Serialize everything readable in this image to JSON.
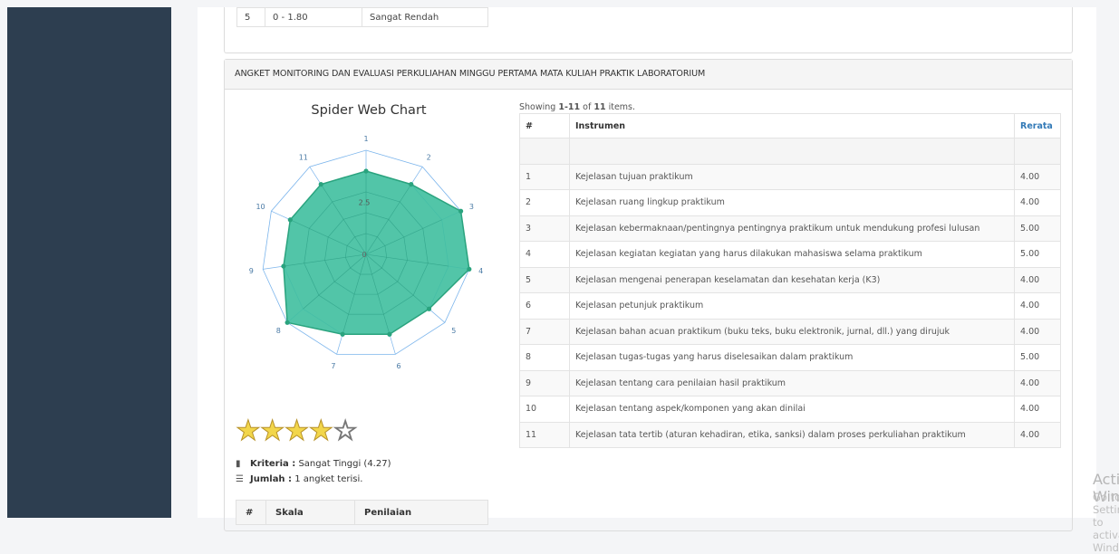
{
  "top_table": {
    "row": {
      "no": "5",
      "range": "0 - 1.80",
      "label": "Sangat Rendah"
    }
  },
  "panel": {
    "heading": "ANGKET MONITORING DAN EVALUASI PERKULIAHAN MINGGU PERTAMA MATA KULIAH PRAKTIK LABORATORIUM"
  },
  "chart_data": {
    "type": "radar",
    "title": "Spider Web Chart",
    "categories": [
      "1",
      "2",
      "3",
      "4",
      "5",
      "6",
      "7",
      "8",
      "9",
      "10",
      "11"
    ],
    "values": [
      4.0,
      4.0,
      5.0,
      5.0,
      4.0,
      4.0,
      4.0,
      5.0,
      4.0,
      4.0,
      4.0
    ],
    "ylim": [
      0,
      5
    ],
    "tick_labels": [
      "0",
      "2.5"
    ],
    "fill_color": "#3fbf9f",
    "line_color": "#2aa37e",
    "grid_color": "#7cb5ec"
  },
  "rating": {
    "stars_filled": 4,
    "stars_total": 5,
    "kriteria_label": "Kriteria :",
    "kriteria_value": "Sangat Tinggi (4.27)",
    "jumlah_label": "Jumlah :",
    "jumlah_value": "1 angket terisi."
  },
  "summary_table": {
    "headers": [
      "#",
      "Skala",
      "Penilaian"
    ]
  },
  "grid": {
    "showing_prefix": "Showing ",
    "showing_range": "1-11",
    "showing_mid": " of ",
    "showing_total": "11",
    "showing_suffix": " items.",
    "headers": [
      "#",
      "Instrumen",
      "Rerata"
    ],
    "rows": [
      {
        "no": "1",
        "instrumen": "Kejelasan tujuan praktikum",
        "rerata": "4.00"
      },
      {
        "no": "2",
        "instrumen": "Kejelasan ruang lingkup praktikum",
        "rerata": "4.00"
      },
      {
        "no": "3",
        "instrumen": "Kejelasan kebermaknaan/pentingnya pentingnya praktikum untuk mendukung profesi lulusan",
        "rerata": "5.00"
      },
      {
        "no": "4",
        "instrumen": "Kejelasan kegiatan kegiatan yang harus dilakukan mahasiswa selama praktikum",
        "rerata": "5.00"
      },
      {
        "no": "5",
        "instrumen": "Kejelasan mengenai penerapan keselamatan dan kesehatan kerja (K3)",
        "rerata": "4.00"
      },
      {
        "no": "6",
        "instrumen": "Kejelasan petunjuk praktikum",
        "rerata": "4.00"
      },
      {
        "no": "7",
        "instrumen": "Kejelasan bahan acuan praktikum (buku teks, buku elektronik, jurnal, dll.) yang dirujuk",
        "rerata": "4.00"
      },
      {
        "no": "8",
        "instrumen": "Kejelasan tugas-tugas yang harus diselesaikan dalam praktikum",
        "rerata": "5.00"
      },
      {
        "no": "9",
        "instrumen": "Kejelasan tentang cara penilaian hasil praktikum",
        "rerata": "4.00"
      },
      {
        "no": "10",
        "instrumen": "Kejelasan tentang aspek/komponen yang akan dinilai",
        "rerata": "4.00"
      },
      {
        "no": "11",
        "instrumen": "Kejelasan tata tertib (aturan kehadiran, etika, sanksi) dalam proses perkuliahan praktikum",
        "rerata": "4.00"
      }
    ]
  },
  "watermark": {
    "line1": "Activate Windows",
    "line2": "Go to Settings to activate Windows."
  }
}
